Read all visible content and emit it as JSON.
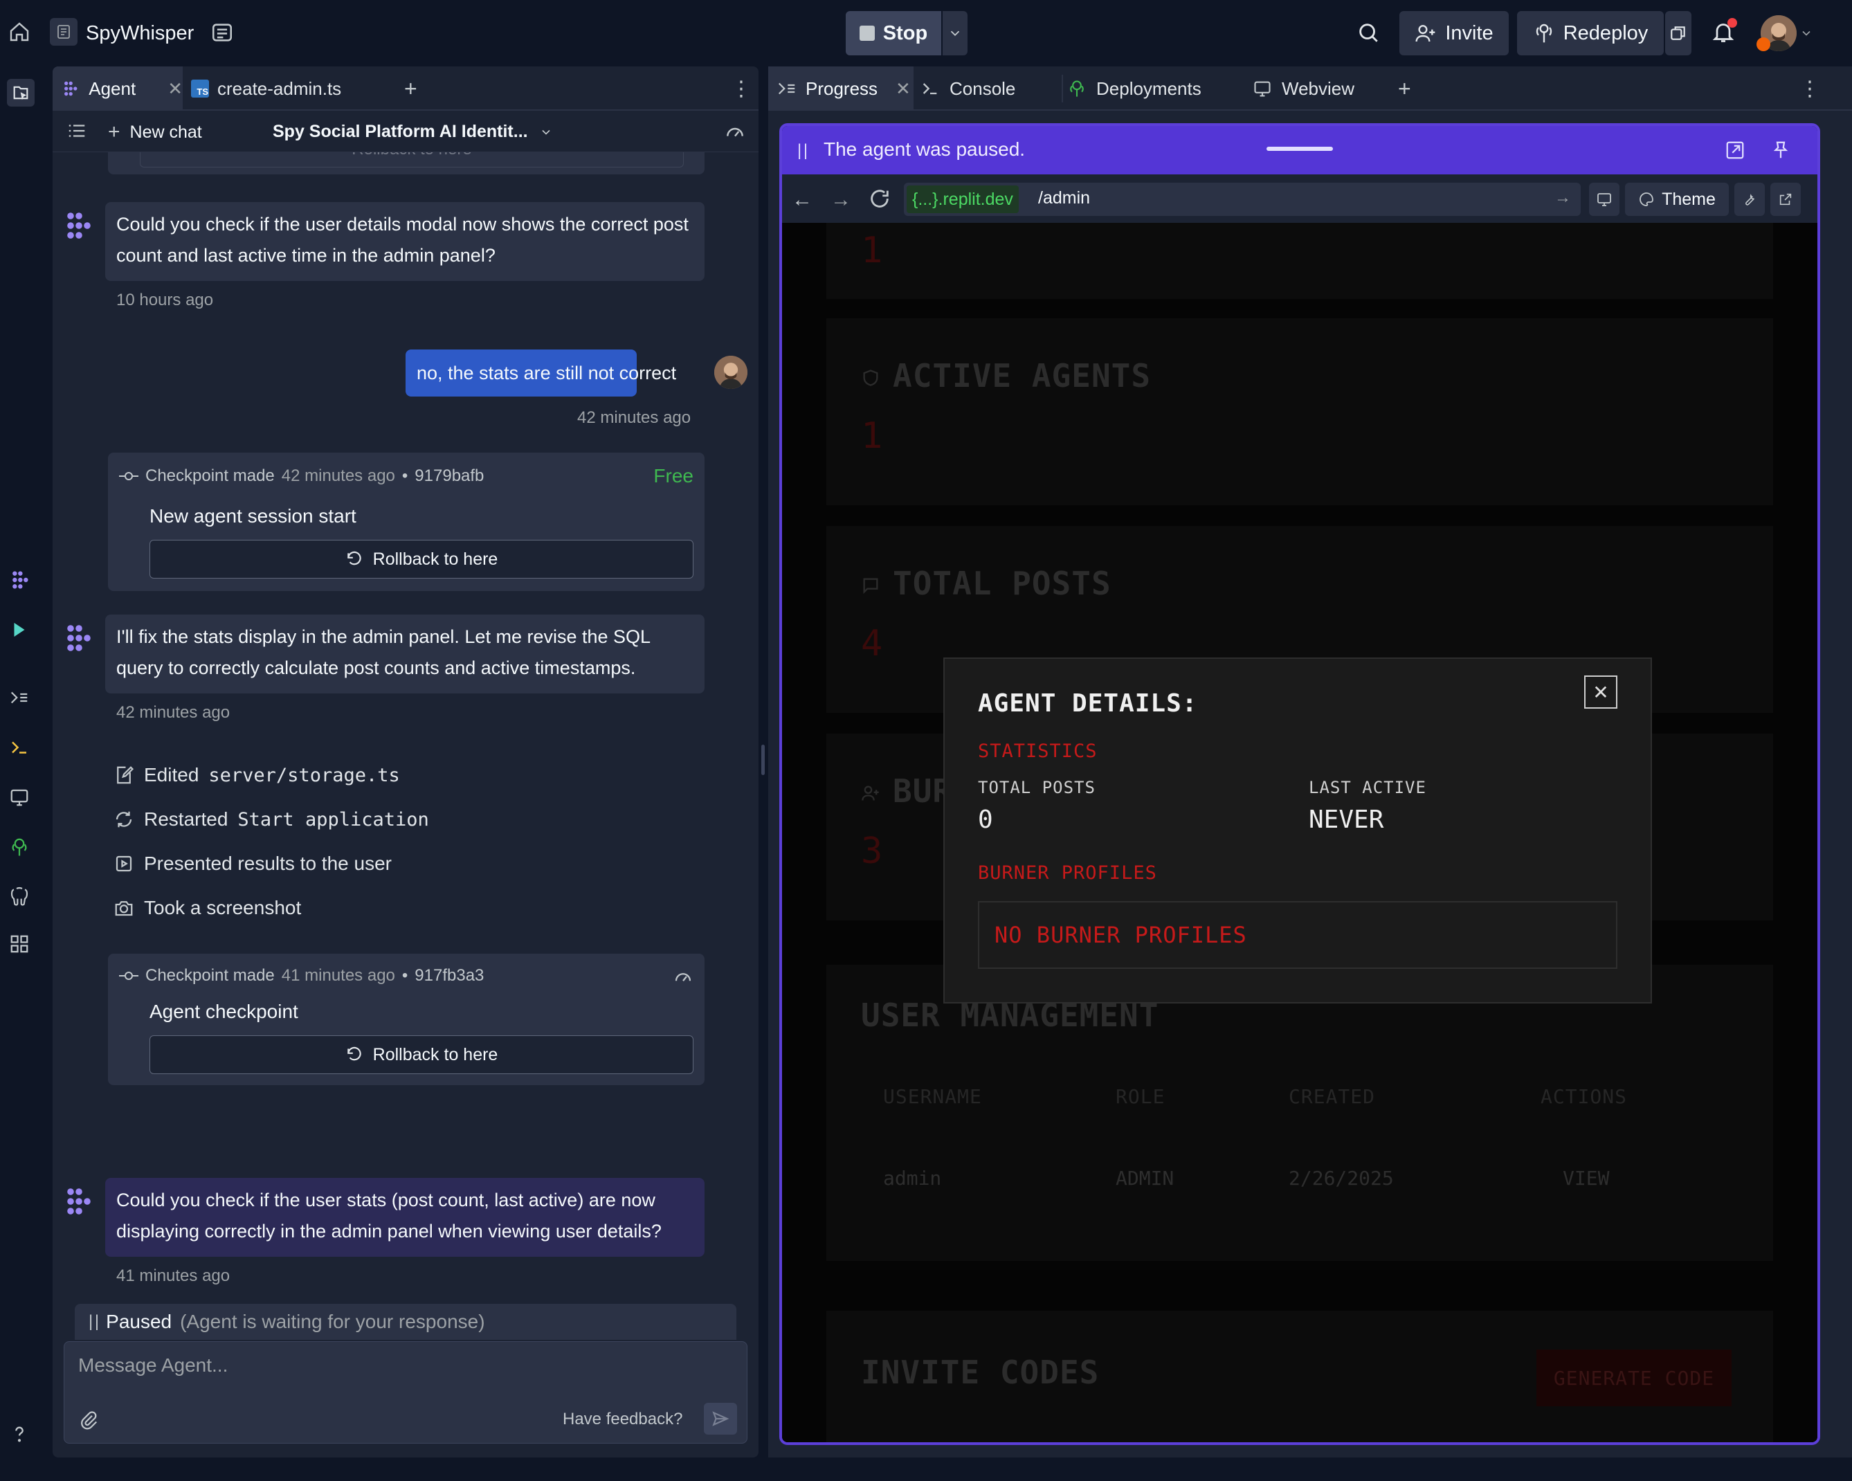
{
  "topbar": {
    "project_name": "SpyWhisper",
    "stop_label": "Stop",
    "invite_label": "Invite",
    "redeploy_label": "Redeploy"
  },
  "agent_panel": {
    "tabs": [
      {
        "label": "Agent"
      },
      {
        "label": "create-admin.ts"
      }
    ],
    "new_chat_label": "New chat",
    "chat_title": "Spy Social Platform AI Identit...",
    "clipped_rollback_label": "Rollback to here",
    "messages": {
      "m1": {
        "text": "Could you check if the user details modal now shows the correct post count and last active time in the admin panel?",
        "time": "10 hours ago"
      },
      "u1": {
        "text": "no, the stats are still not correct",
        "time": "42 minutes ago"
      },
      "cp1": {
        "made": "Checkpoint made",
        "when": "42 minutes ago",
        "sep": "•",
        "hash": "9179bafb",
        "badge": "Free",
        "title": "New agent session start",
        "rollback": "Rollback to here"
      },
      "m2": {
        "text": "I'll fix the stats display in the admin panel. Let me revise the SQL query to correctly calculate post counts and active timestamps.",
        "time": "42 minutes ago"
      },
      "actions": [
        {
          "verb": "Edited",
          "code": "server/storage.ts"
        },
        {
          "verb": "Restarted",
          "code": "Start application"
        },
        {
          "verb": "Presented results to the user",
          "code": ""
        },
        {
          "verb": "Took a screenshot",
          "code": ""
        }
      ],
      "cp2": {
        "made": "Checkpoint made",
        "when": "41 minutes ago",
        "sep": "•",
        "hash": "917fb3a3",
        "title": "Agent checkpoint",
        "rollback": "Rollback to here"
      },
      "m3": {
        "text": "Could you check if the user stats (post count, last active) are now displaying correctly in the admin panel when viewing user details?",
        "time": "41 minutes ago"
      }
    },
    "paused_label": "Paused",
    "paused_sub": "(Agent is waiting for your response)",
    "input_placeholder": "Message Agent...",
    "feedback_label": "Have feedback?"
  },
  "right_panel": {
    "tabs": [
      {
        "label": "Progress"
      },
      {
        "label": "Console"
      },
      {
        "label": "Deployments"
      },
      {
        "label": "Webview"
      }
    ],
    "paused_banner": "The agent was paused.",
    "url_domain": "{...}.replit.dev",
    "url_path": "/admin",
    "theme_label": "Theme"
  },
  "webview": {
    "cards": {
      "top_value": "1",
      "active_agents": {
        "title": "ACTIVE AGENTS",
        "value": "1"
      },
      "total_posts": {
        "title": "TOTAL POSTS",
        "value": "4"
      },
      "burner": {
        "title": "BUR",
        "value": "3"
      }
    },
    "user_management": {
      "title": "USER MANAGEMENT",
      "columns": [
        "USERNAME",
        "ROLE",
        "CREATED",
        "ACTIONS"
      ],
      "rows": [
        {
          "username": "admin",
          "role": "ADMIN",
          "created": "2/26/2025",
          "action": "VIEW"
        }
      ]
    },
    "invite_codes": {
      "title": "INVITE CODES",
      "generate_label": "GENERATE CODE"
    },
    "modal": {
      "title": "AGENT DETAILS:",
      "statistics_label": "STATISTICS",
      "total_posts_label": "TOTAL POSTS",
      "total_posts_value": "0",
      "last_active_label": "LAST ACTIVE",
      "last_active_value": "NEVER",
      "burner_label": "BURNER PROFILES",
      "burner_empty": "NO BURNER PROFILES"
    }
  },
  "colors": {
    "accent": "#5436d6",
    "panel": "#1c2333",
    "free_badge": "#3fb950",
    "alert_red": "#ff1a1a"
  }
}
